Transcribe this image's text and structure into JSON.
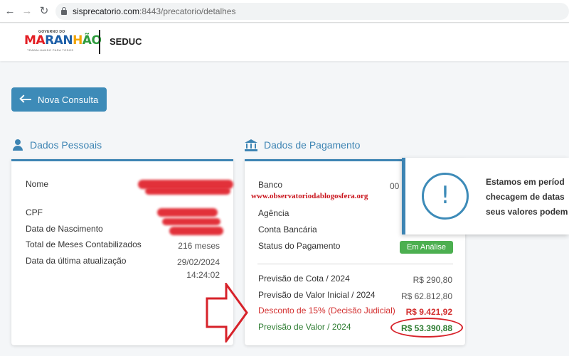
{
  "browser": {
    "url_host": "sisprecatorio.com",
    "url_rest": ":8443/precatorio/detalhes"
  },
  "header": {
    "logo": {
      "top_text": "GOVERNO DO",
      "brand": [
        "MA",
        "RAN",
        "H",
        "ÃO"
      ],
      "sub_text": "TRABALHANDO PARA TODOS"
    },
    "title": "SEDUC"
  },
  "nova_consulta": {
    "label": "Nova Consulta"
  },
  "dados_pessoais": {
    "title": "Dados Pessoais",
    "fields": {
      "nome": "Nome",
      "cpf": "CPF",
      "nascimento": "Data de Nascimento",
      "meses_label": "Total de Meses Contabilizados",
      "meses_value": "216 meses",
      "atualizacao_label": "Data da última atualização",
      "atualizacao_date": "29/02/2024",
      "atualizacao_time": "14:24:02"
    }
  },
  "dados_pagamento": {
    "title": "Dados de Pagamento",
    "banco_label": "Banco",
    "banco_value": "00",
    "watermark": "www.observatoriodablogosfera.org",
    "agencia_label": "Agência",
    "conta_label": "Conta Bancária",
    "status_label": "Status do Pagamento",
    "status_value": "Em Análise",
    "previsoes": [
      {
        "label": "Previsão de Cota / 2024",
        "value": "R$ 290,80"
      },
      {
        "label": "Previsão de Valor Inicial / 2024",
        "value": "R$ 62.812,80"
      },
      {
        "label": "Desconto de 15% (Decisão Judicial)",
        "value": "R$ 9.421,92"
      },
      {
        "label": "Previsão de Valor / 2024",
        "value": "R$ 53.390,88"
      }
    ]
  },
  "toast": {
    "icon_glyph": "!",
    "lines": [
      "Estamos em períod",
      "checagem de datas",
      "seus valores podem"
    ]
  },
  "colors": {
    "accent": "#3d84b3",
    "status_green": "#4caf50",
    "discount_red": "#d32f2f",
    "final_green": "#2e7d32"
  }
}
